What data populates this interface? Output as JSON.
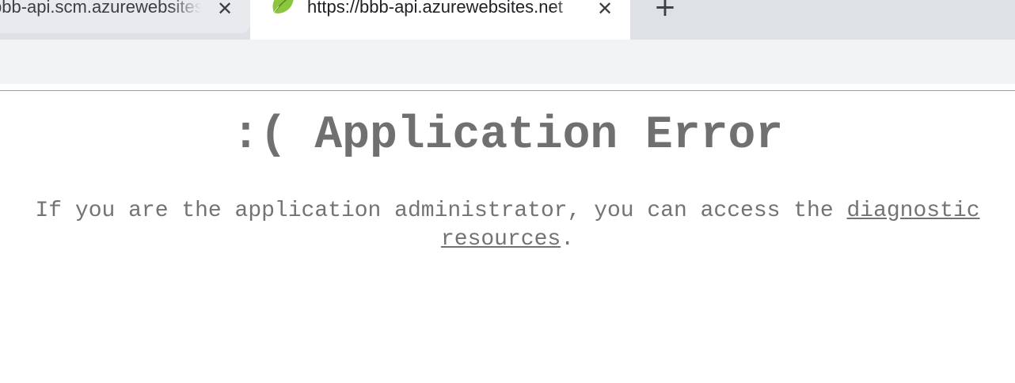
{
  "browser": {
    "tabs": [
      {
        "title": "bbb-api.scm.azurewebsites.net",
        "active": false,
        "close_glyph": "✕"
      },
      {
        "title": "https://bbb-api.azurewebsites.net",
        "active": true,
        "favicon": "spring-leaf-icon",
        "close_glyph": "✕"
      }
    ],
    "new_tab_glyph": "+"
  },
  "page": {
    "heading": ":( Application Error",
    "message_prefix": "If you are the application administrator, you can access the",
    "link_text": "diagnostic resources",
    "message_suffix": "."
  },
  "colors": {
    "tabstrip": "#dee1e6",
    "active_tab": "#ffffff",
    "toolbar": "#f1f3f4",
    "error_text": "#737373",
    "favicon_green": "#8cc63f"
  }
}
